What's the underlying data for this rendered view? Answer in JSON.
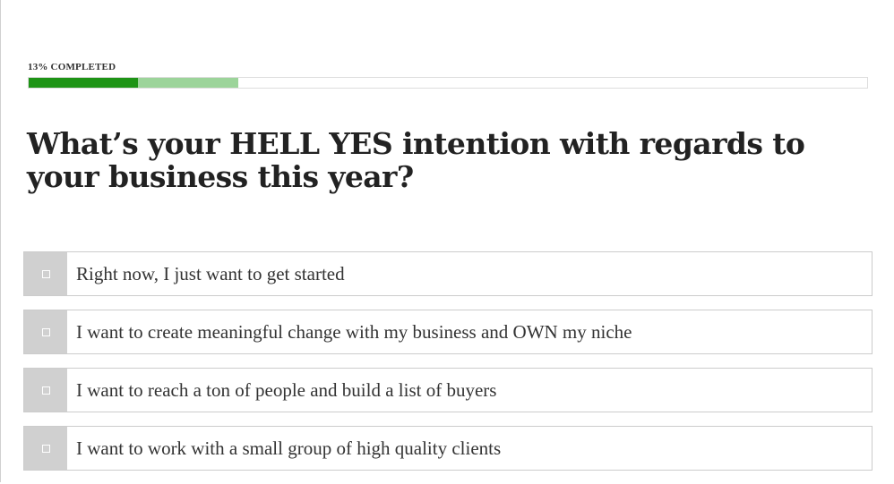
{
  "progress": {
    "label": "13% COMPLETED",
    "completed_percent": 13,
    "buffer_percent": 25,
    "fill_color": "#1e9416",
    "buffer_color": "#9cd49a"
  },
  "question": {
    "text": "What’s your HELL YES intention with regards to your business this year?"
  },
  "options": [
    {
      "label": "Right now, I just want to get started",
      "checked": false
    },
    {
      "label": "I want to create meaningful change with my business and OWN my niche",
      "checked": false
    },
    {
      "label": "I want to reach a ton of people and build a list of buyers",
      "checked": false
    },
    {
      "label": "I want to work with a small group of high quality clients",
      "checked": false
    }
  ]
}
